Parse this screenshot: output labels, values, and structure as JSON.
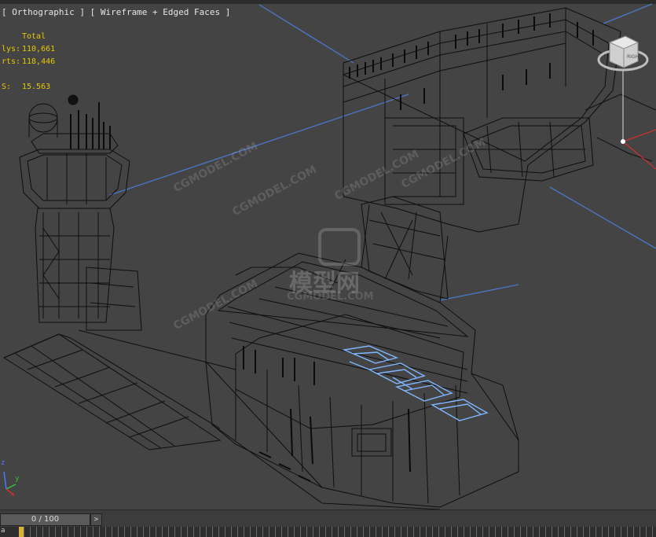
{
  "viewport": {
    "label": "[ Orthographic ] [ Wireframe + Edged Faces ]",
    "stats": {
      "header": "Total",
      "polys_label": "lys:",
      "polys_value": "110,661",
      "verts_label": "rts:",
      "verts_value": "118,446",
      "fps_label": "S:",
      "fps_value": "15.563"
    },
    "watermarks": [
      "CGMODEL.COM",
      "CGMODEL.COM",
      "CGMODEL.COM",
      "CGMODEL.COM",
      "CGMODEL.COM",
      "CGMODEL.COM",
      "模型网"
    ],
    "viewcube_label": "RIGHT",
    "axis_labels": {
      "x": "x",
      "y": "y",
      "z": "z"
    }
  },
  "timeline": {
    "slider_label": "0 / 100",
    "next_button": ">"
  },
  "trackbar": {
    "left_label": "a"
  },
  "colors": {
    "background": "#444444",
    "wire": "#111111",
    "grid_line": "#4a78c8",
    "selection": "#7fb6ff",
    "stats": "#e6c800"
  }
}
